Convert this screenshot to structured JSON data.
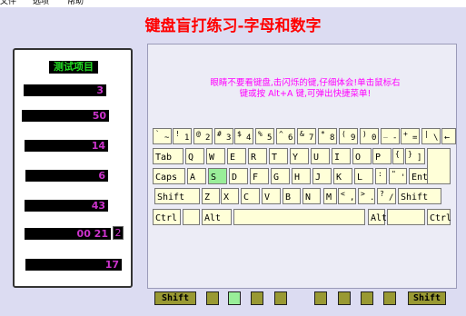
{
  "menu": [
    "文件",
    "选项",
    "帮助"
  ],
  "title": "键盘盲打练习-字母和数字",
  "stats": {
    "header": "测试项目",
    "rows": [
      "3",
      "50",
      "14",
      "6",
      "43",
      "00  21",
      "17"
    ],
    "extra": "2"
  },
  "message": {
    "line1": "眼睛不要看键盘,击闪烁的键,仔细体会!单击鼠标右",
    "line2": "键或按 Alt+A 键,可弹出快捷菜单!"
  },
  "keyboard": {
    "highlight": "S",
    "row1": [
      {
        "main": "~",
        "shift": "`"
      },
      {
        "main": "1",
        "shift": "!"
      },
      {
        "main": "2",
        "shift": "@"
      },
      {
        "main": "3",
        "shift": "#"
      },
      {
        "main": "4",
        "shift": "$"
      },
      {
        "main": "5",
        "shift": "%"
      },
      {
        "main": "6",
        "shift": "^"
      },
      {
        "main": "7",
        "shift": "&"
      },
      {
        "main": "8",
        "shift": "*"
      },
      {
        "main": "9",
        "shift": "("
      },
      {
        "main": "0",
        "shift": ")"
      },
      {
        "main": "-",
        "shift": "_"
      },
      {
        "main": "=",
        "shift": "+"
      },
      {
        "main": "\\",
        "shift": "|"
      },
      {
        "main": "←",
        "shift": ""
      }
    ],
    "row2": [
      "Tab",
      "Q",
      "W",
      "E",
      "R",
      "T",
      "Y",
      "U",
      "I",
      "O",
      "P",
      "[",
      "]"
    ],
    "row2_shift": [
      "",
      "",
      "",
      "",
      "",
      "",
      "",
      "",
      "",
      "",
      "",
      "{",
      "}"
    ],
    "row3": [
      "Caps",
      "A",
      "S",
      "D",
      "F",
      "G",
      "H",
      "J",
      "K",
      "L",
      ";",
      "'",
      "Enter"
    ],
    "row3_shift": [
      "",
      "",
      "",
      "",
      "",
      "",
      "",
      "",
      "",
      "",
      ":",
      "\"",
      ""
    ],
    "row4": [
      "Shift",
      "Z",
      "X",
      "C",
      "V",
      "B",
      "N",
      "M",
      ",",
      ".",
      "/",
      "Shift"
    ],
    "row4_shift": [
      "",
      "",
      "",
      "",
      "",
      "",
      "",
      "",
      "<",
      ">",
      "?",
      ""
    ],
    "row5": [
      "Ctrl",
      "",
      "Alt",
      "",
      "Alt",
      "",
      "Ctrl"
    ]
  },
  "footer": {
    "left_shift": "Shift",
    "right_shift": "Shift"
  }
}
